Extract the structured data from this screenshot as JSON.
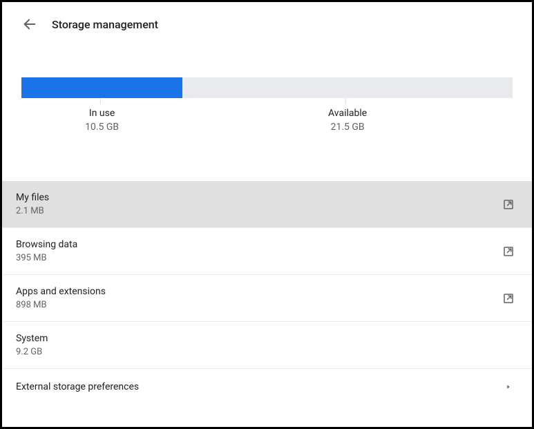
{
  "header": {
    "title": "Storage management"
  },
  "storage": {
    "in_use_label": "In use",
    "in_use_value": "10.5 GB",
    "available_label": "Available",
    "available_value": "21.5 GB",
    "fill_percent": 32.8
  },
  "items": [
    {
      "title": "My files",
      "size": "2.1 MB",
      "icon": "external-link",
      "highlight": true
    },
    {
      "title": "Browsing data",
      "size": "395 MB",
      "icon": "external-link",
      "highlight": false
    },
    {
      "title": "Apps and extensions",
      "size": "898 MB",
      "icon": "external-link",
      "highlight": false
    },
    {
      "title": "System",
      "size": "9.2 GB",
      "icon": null,
      "highlight": false
    },
    {
      "title": "External storage preferences",
      "size": null,
      "icon": "chevron-right",
      "highlight": false
    }
  ],
  "colors": {
    "accent": "#1a73e8",
    "bar_track": "#e8eaed"
  }
}
